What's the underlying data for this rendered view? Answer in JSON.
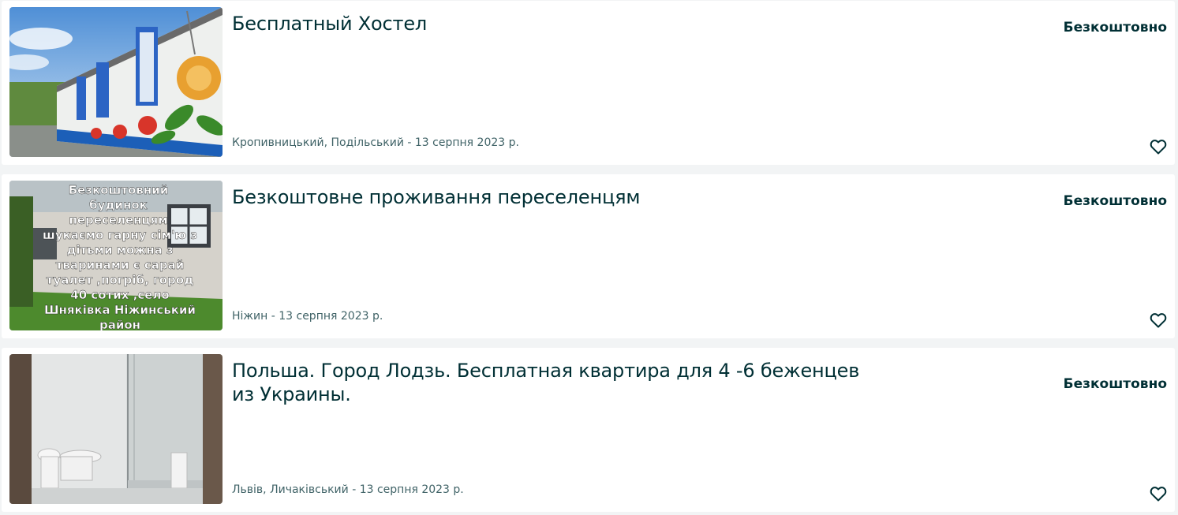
{
  "listings": [
    {
      "title": "Бесплатный Хостел",
      "location_date": "Кропивницький, Подільський - 13 серпня 2023 р.",
      "price": "Безкоштовно",
      "image_alt": "Painted house with flowers"
    },
    {
      "title": "Безкоштовне проживання переселенцям",
      "location_date": "Ніжин - 13 серпня 2023 р.",
      "price": "Безкоштовно",
      "image_alt": "House with text overlay",
      "image_text": [
        "Безкоштовний",
        "будинок",
        "переселенцям",
        "шукаємо гарну сім'ю з",
        "дітьми можна з",
        "тваринами є сарай",
        "туалет ,погріб, город",
        "40 сотих ,село",
        "Шняківка Ніжинський",
        "район"
      ]
    },
    {
      "title": "Польша. Город Лодзь. Бесплатная квартира для 4 -6 беженцев из Украины.",
      "location_date": "Львів, Личаківський - 13 серпня 2023 р.",
      "price": "Безкоштовно",
      "image_alt": "Bathroom with shower and toilet"
    }
  ],
  "icons": {
    "favorite": "heart-outline-icon"
  },
  "colors": {
    "text": "#002f34",
    "meta": "#406367",
    "background": "#f2f4f5",
    "card": "#ffffff"
  }
}
